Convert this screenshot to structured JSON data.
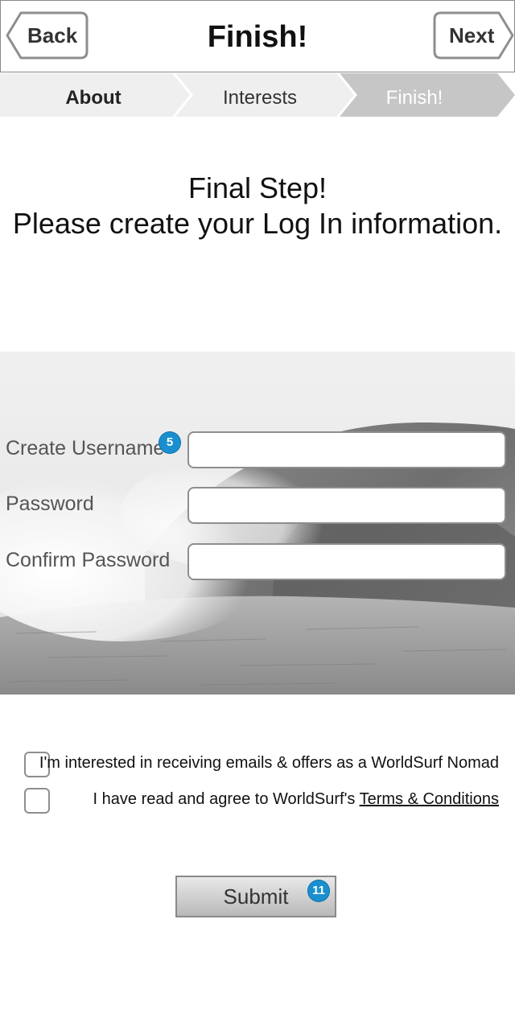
{
  "header": {
    "back_label": "Back",
    "title": "Finish!",
    "next_label": "Next"
  },
  "steps": [
    {
      "label": "About"
    },
    {
      "label": "Interests"
    },
    {
      "label": "Finish!"
    }
  ],
  "intro": {
    "line1": "Final Step!",
    "line2": "Please create your Log In information."
  },
  "form": {
    "username": {
      "label": "Create Username",
      "value": "",
      "badge": "5"
    },
    "password": {
      "label": "Password",
      "value": ""
    },
    "confirm": {
      "label": "Confirm  Password",
      "value": ""
    }
  },
  "options": {
    "emails": {
      "text": "I'm interested in receiving emails & offers as a WorldSurf Nomad",
      "checked": false
    },
    "terms": {
      "text_prefix": "I have read and agree to WorldSurf's ",
      "link": "Terms & Conditions",
      "checked": false
    }
  },
  "submit": {
    "label": "Submit",
    "badge": "11"
  },
  "colors": {
    "badge": "#1a8fd0",
    "active_step": "#c6c6c6",
    "inactive_step": "#efefef"
  }
}
